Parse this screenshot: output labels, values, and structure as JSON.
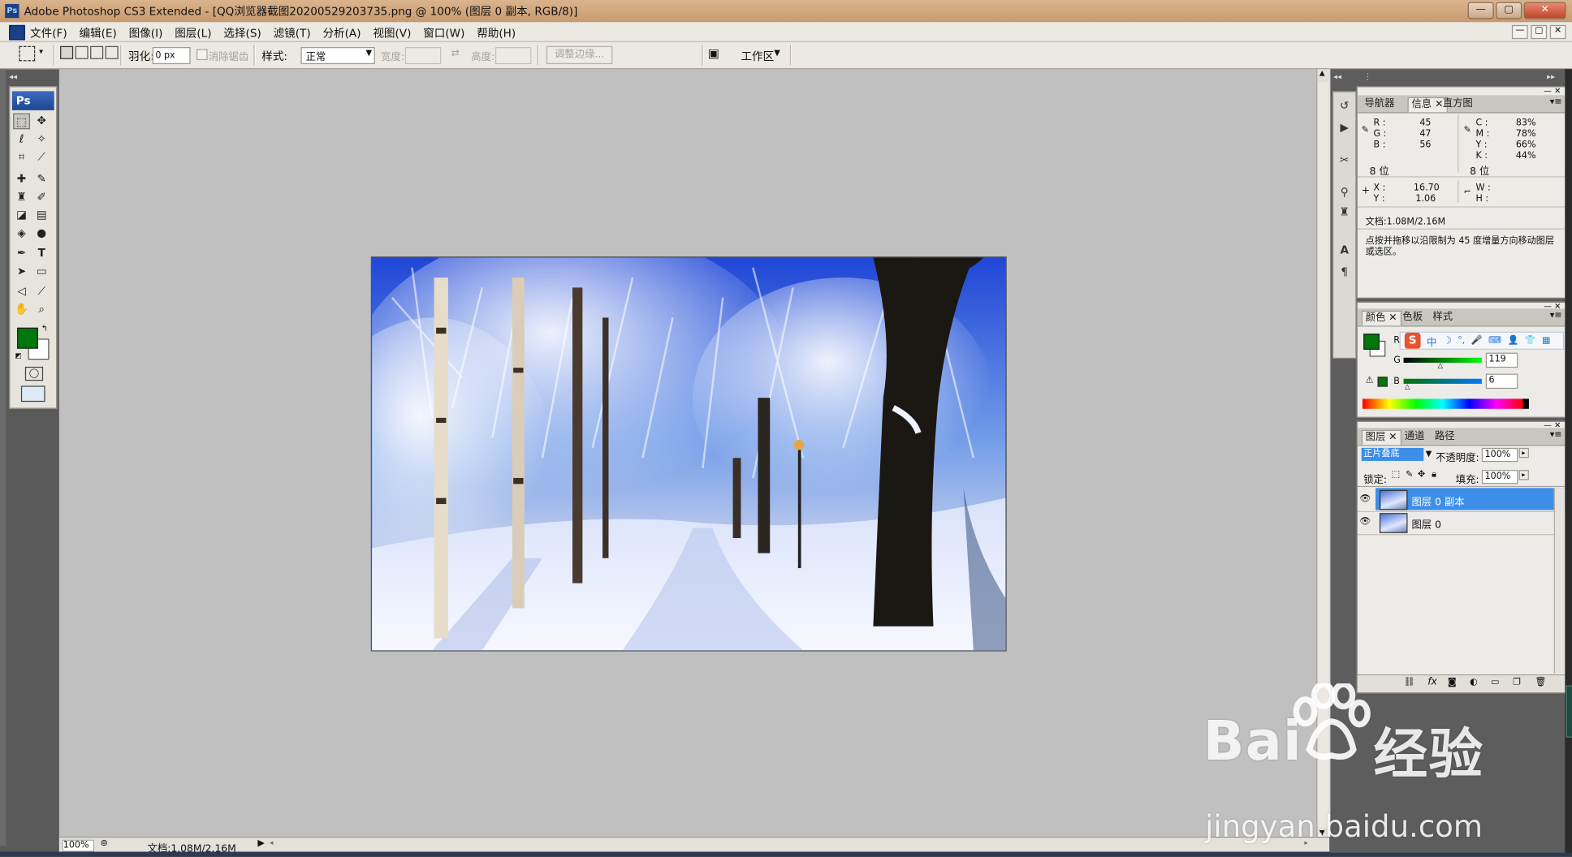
{
  "window": {
    "title": "Adobe Photoshop CS3 Extended - [QQ浏览器截图20200529203735.png @ 100% (图层 0 副本, RGB/8)]",
    "controls": [
      "—",
      "▢",
      "✕"
    ]
  },
  "menu": {
    "items": [
      "文件(F)",
      "编辑(E)",
      "图像(I)",
      "图层(L)",
      "选择(S)",
      "滤镜(T)",
      "分析(A)",
      "视图(V)",
      "窗口(W)",
      "帮助(H)"
    ],
    "doc_controls": [
      "—",
      "▢",
      "✕"
    ]
  },
  "options": {
    "feather_label": "羽化:",
    "feather_value": "0 px",
    "antialias_label": "消除锯齿",
    "style_label": "样式:",
    "style_value": "正常",
    "width_label": "宽度:",
    "height_label": "高度:",
    "refine_edge": "调整边缘...",
    "workspace": "工作区"
  },
  "toolbox": {
    "badge": "Ps"
  },
  "status": {
    "zoom": "100%",
    "doc_size": "文档:1.08M/2.16M"
  },
  "info_panel": {
    "tabs": [
      "导航器",
      "信息",
      "直方图"
    ],
    "r_label": "R :",
    "r_value": "45",
    "g_label": "G :",
    "g_value": "47",
    "b_label": "B :",
    "b_value": "56",
    "bits_left": "8 位",
    "c_label": "C :",
    "c_value": "83%",
    "m_label": "M :",
    "m_value": "78%",
    "y_label": "Y :",
    "y_value": "66%",
    "k_label": "K :",
    "k_value": "44%",
    "bits_right": "8 位",
    "x_label": "X :",
    "x_value": "16.70",
    "ypos_label": "Y :",
    "ypos_value": "1.06",
    "w_label": "W :",
    "h_label": "H :",
    "doc": "文档:1.08M/2.16M",
    "hint": "点按并拖移以沿限制为 45 度增量方向移动图层或选区。"
  },
  "color_panel": {
    "tabs": [
      "颜色",
      "色板",
      "样式"
    ],
    "r_label": "R",
    "g_label": "G",
    "g_value": "119",
    "b_label": "B",
    "b_value": "6",
    "fg_color": "#00770a",
    "ime_items": [
      "中",
      "☽",
      "°,",
      "🎤",
      "⌨",
      "👤",
      "👕",
      "▦"
    ]
  },
  "layers_panel": {
    "tabs": [
      "图层",
      "通道",
      "路径"
    ],
    "blend_mode": "正片叠底",
    "opacity_label": "不透明度:",
    "opacity_value": "100%",
    "lock_label": "锁定:",
    "fill_label": "填充:",
    "fill_value": "100%",
    "layers": [
      {
        "name": "图层 0 副本",
        "selected": true
      },
      {
        "name": "图层 0",
        "selected": false
      }
    ],
    "footer_icons": [
      "link-icon",
      "fx-icon",
      "mask-icon",
      "adjustment-icon",
      "folder-icon",
      "new-layer-icon",
      "trash-icon"
    ]
  },
  "watermark": {
    "brand_left": "Bai",
    "brand_right": "经验",
    "url": "jingyan.baidu.com"
  }
}
